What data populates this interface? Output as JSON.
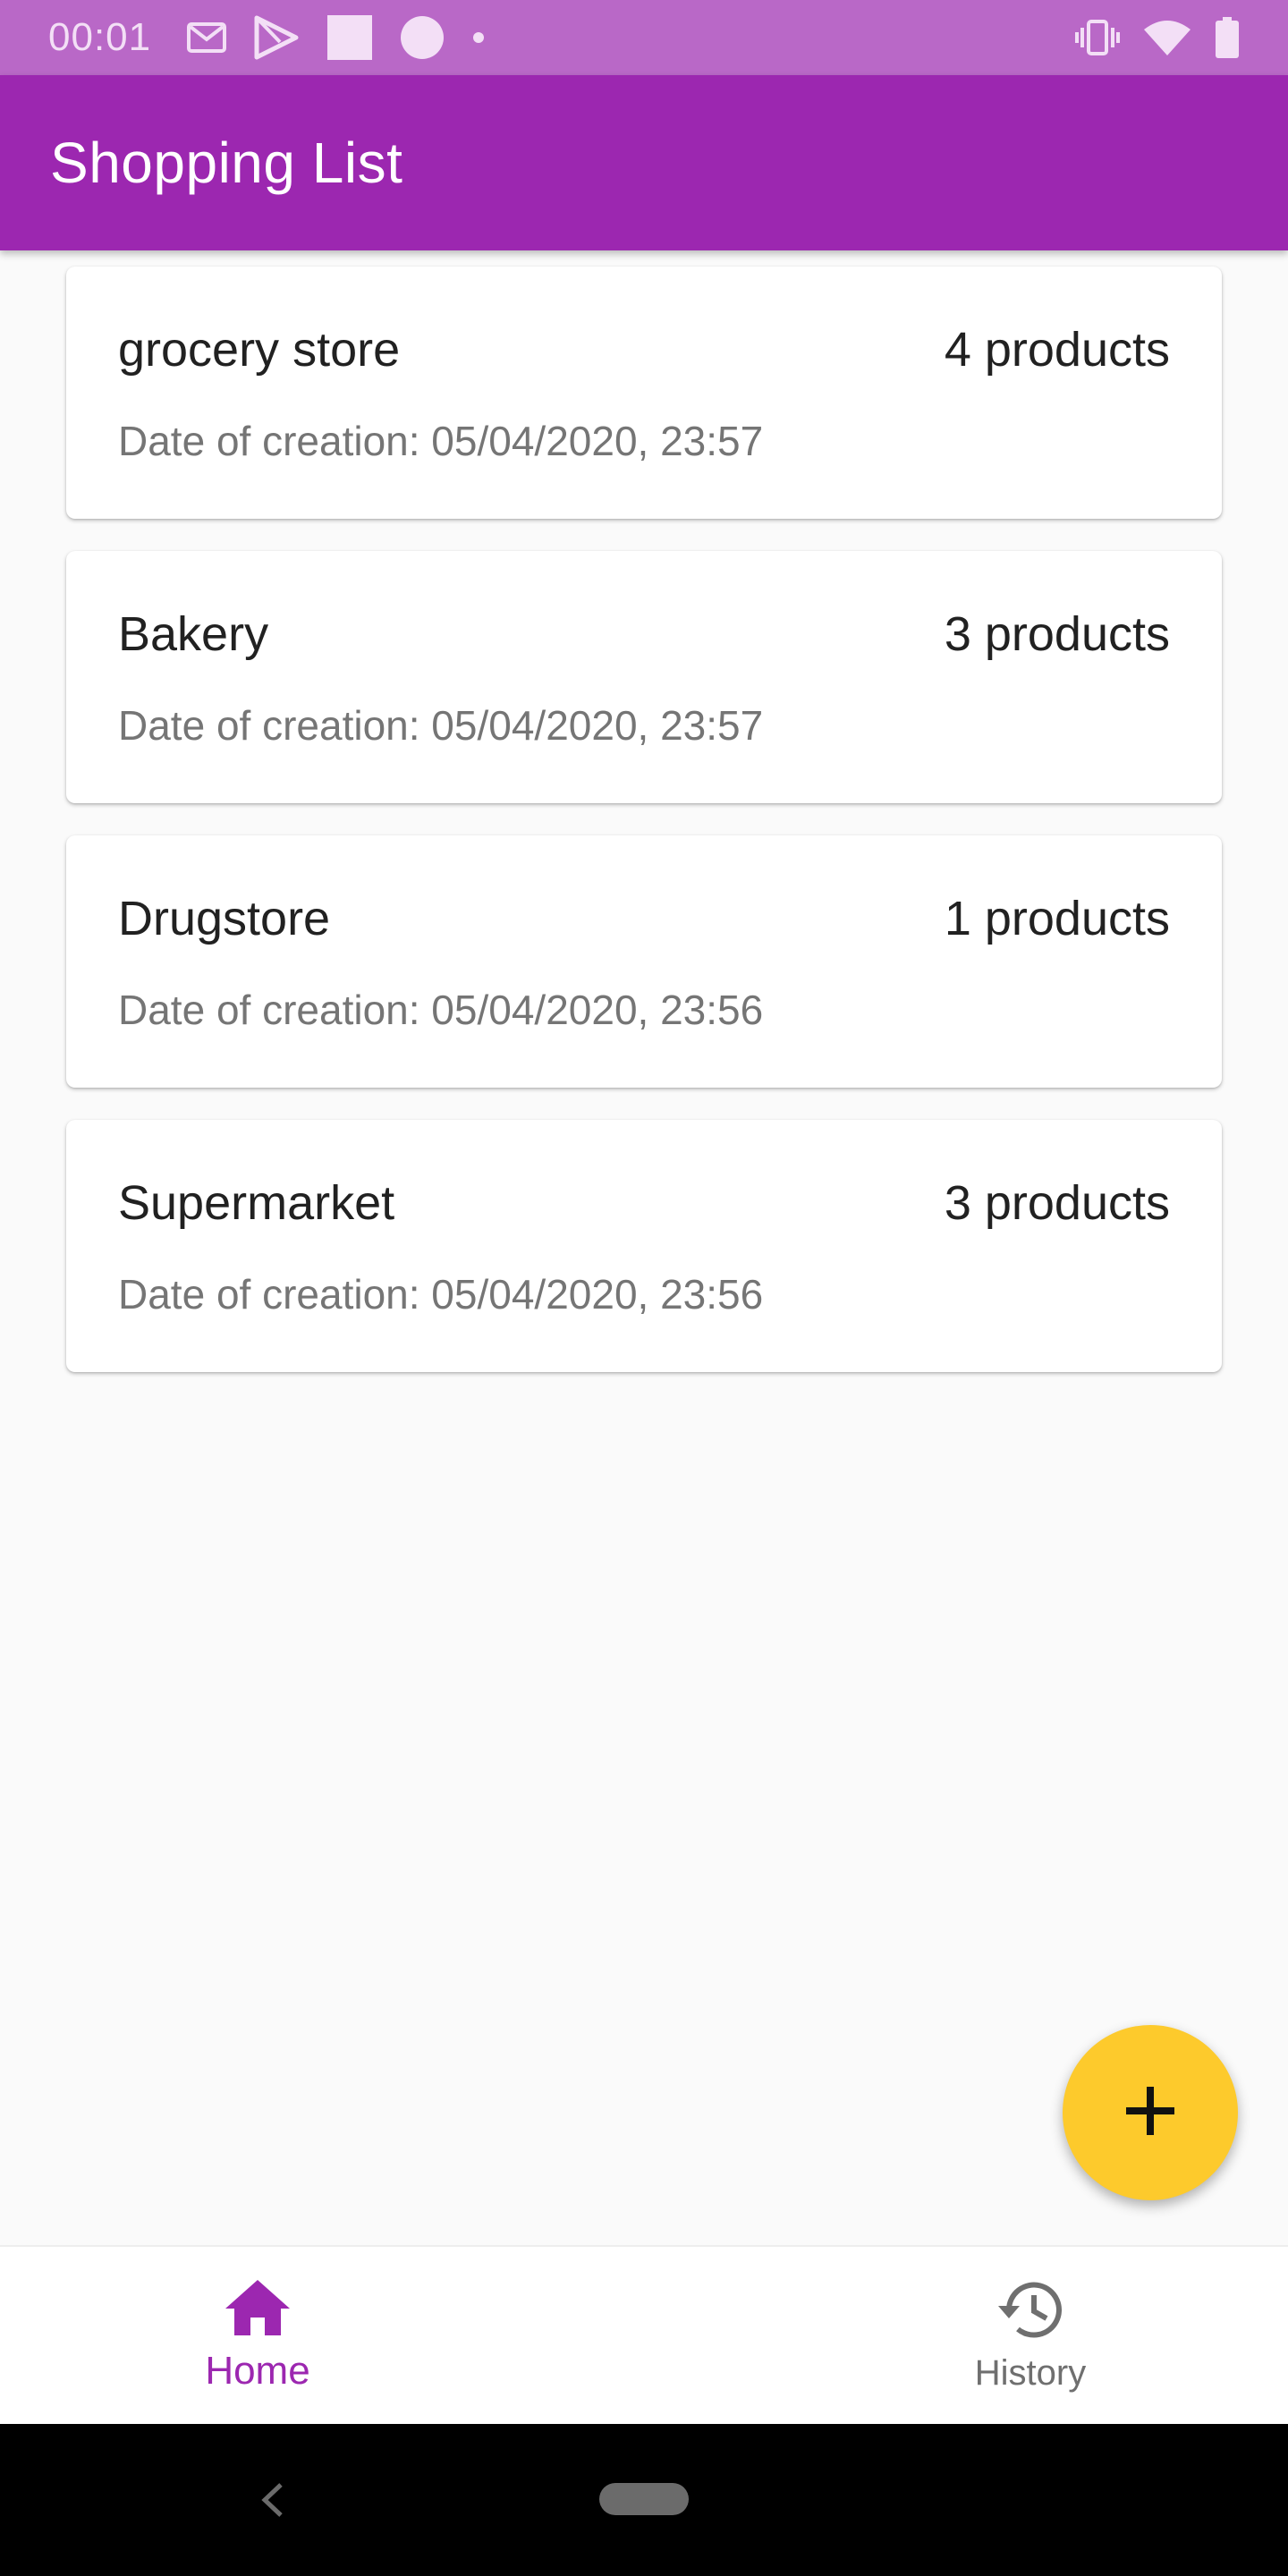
{
  "status_bar": {
    "time": "00:01",
    "left_icons": [
      "gmail-icon",
      "play-store-icon",
      "square-notification-icon",
      "circle-notification-icon",
      "dot-icon"
    ],
    "right_icons": [
      "vibrate-icon",
      "wifi-icon",
      "battery-icon"
    ]
  },
  "app_bar": {
    "title": "Shopping List"
  },
  "lists": [
    {
      "name": "grocery store",
      "count": "4 products",
      "date": "Date of creation: 05/04/2020, 23:57"
    },
    {
      "name": "Bakery",
      "count": "3 products",
      "date": "Date of creation: 05/04/2020, 23:57"
    },
    {
      "name": "Drugstore",
      "count": "1 products",
      "date": "Date of creation: 05/04/2020, 23:56"
    },
    {
      "name": "Supermarket",
      "count": "3 products",
      "date": "Date of creation: 05/04/2020, 23:56"
    }
  ],
  "fab": {
    "icon": "plus-icon"
  },
  "bottom_nav": {
    "home_label": "Home",
    "home_icon": "home-icon",
    "history_label": "History",
    "history_icon": "history-icon"
  },
  "colors": {
    "primary": "#9c27b0",
    "status_bar": "#b968c7",
    "accent": "#fdca2c",
    "background": "#fafafa"
  }
}
